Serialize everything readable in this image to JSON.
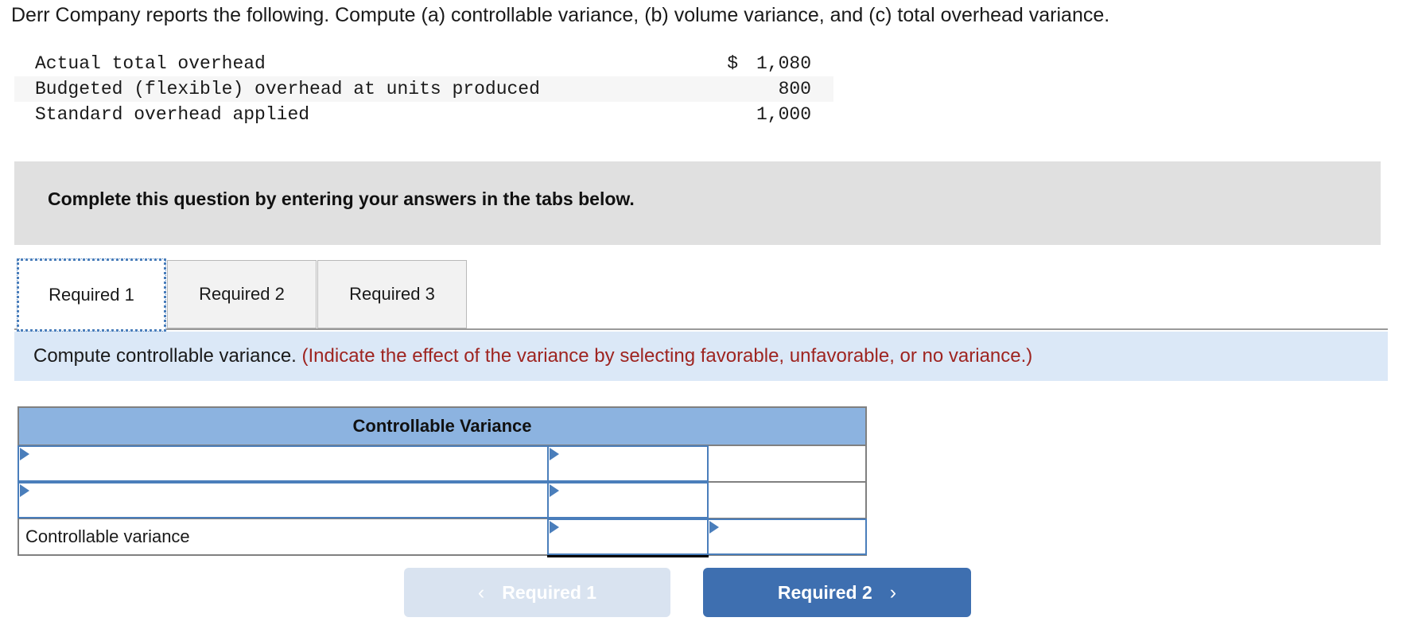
{
  "question": {
    "prompt": "Derr Company reports the following. Compute (a) controllable variance, (b) volume variance, and (c) total overhead variance."
  },
  "given_data": {
    "rows": [
      {
        "label": "Actual total overhead",
        "currency": "$",
        "amount": "1,080"
      },
      {
        "label": "Budgeted (flexible) overhead at units produced",
        "currency": "",
        "amount": "800"
      },
      {
        "label": "Standard overhead applied",
        "currency": "",
        "amount": "1,000"
      }
    ]
  },
  "banner": {
    "text": "Complete this question by entering your answers in the tabs below."
  },
  "tabs": {
    "items": [
      {
        "label": "Required 1",
        "active": true
      },
      {
        "label": "Required 2",
        "active": false
      },
      {
        "label": "Required 3",
        "active": false
      }
    ]
  },
  "instruction": {
    "main": "Compute controllable variance.",
    "hint": "(Indicate the effect of the variance by selecting favorable, unfavorable, or no variance.)"
  },
  "answer_table": {
    "header": "Controllable Variance",
    "rows": [
      {
        "description": "",
        "amount": "",
        "effect": "",
        "desc_is_select": true,
        "amt_is_select": true,
        "eff_is_select": false
      },
      {
        "description": "",
        "amount": "",
        "effect": "",
        "desc_is_select": true,
        "amt_is_select": true,
        "eff_is_select": false
      },
      {
        "description": "Controllable variance",
        "amount": "",
        "effect": "",
        "desc_is_select": false,
        "amt_is_select": true,
        "eff_is_select": true
      }
    ]
  },
  "nav": {
    "prev_label": "Required 1",
    "next_label": "Required 2",
    "prev_chevron": "‹",
    "next_chevron": "›"
  },
  "colors": {
    "table_header_blue": "#8cb3e0",
    "instruction_bar_blue": "#dbe8f7",
    "hint_red": "#9e2420",
    "banner_gray": "#e0e0e0",
    "select_border_blue": "#4a7ebb",
    "next_button_blue": "#3e6fb0",
    "prev_button_blue": "#d9e3f0"
  }
}
